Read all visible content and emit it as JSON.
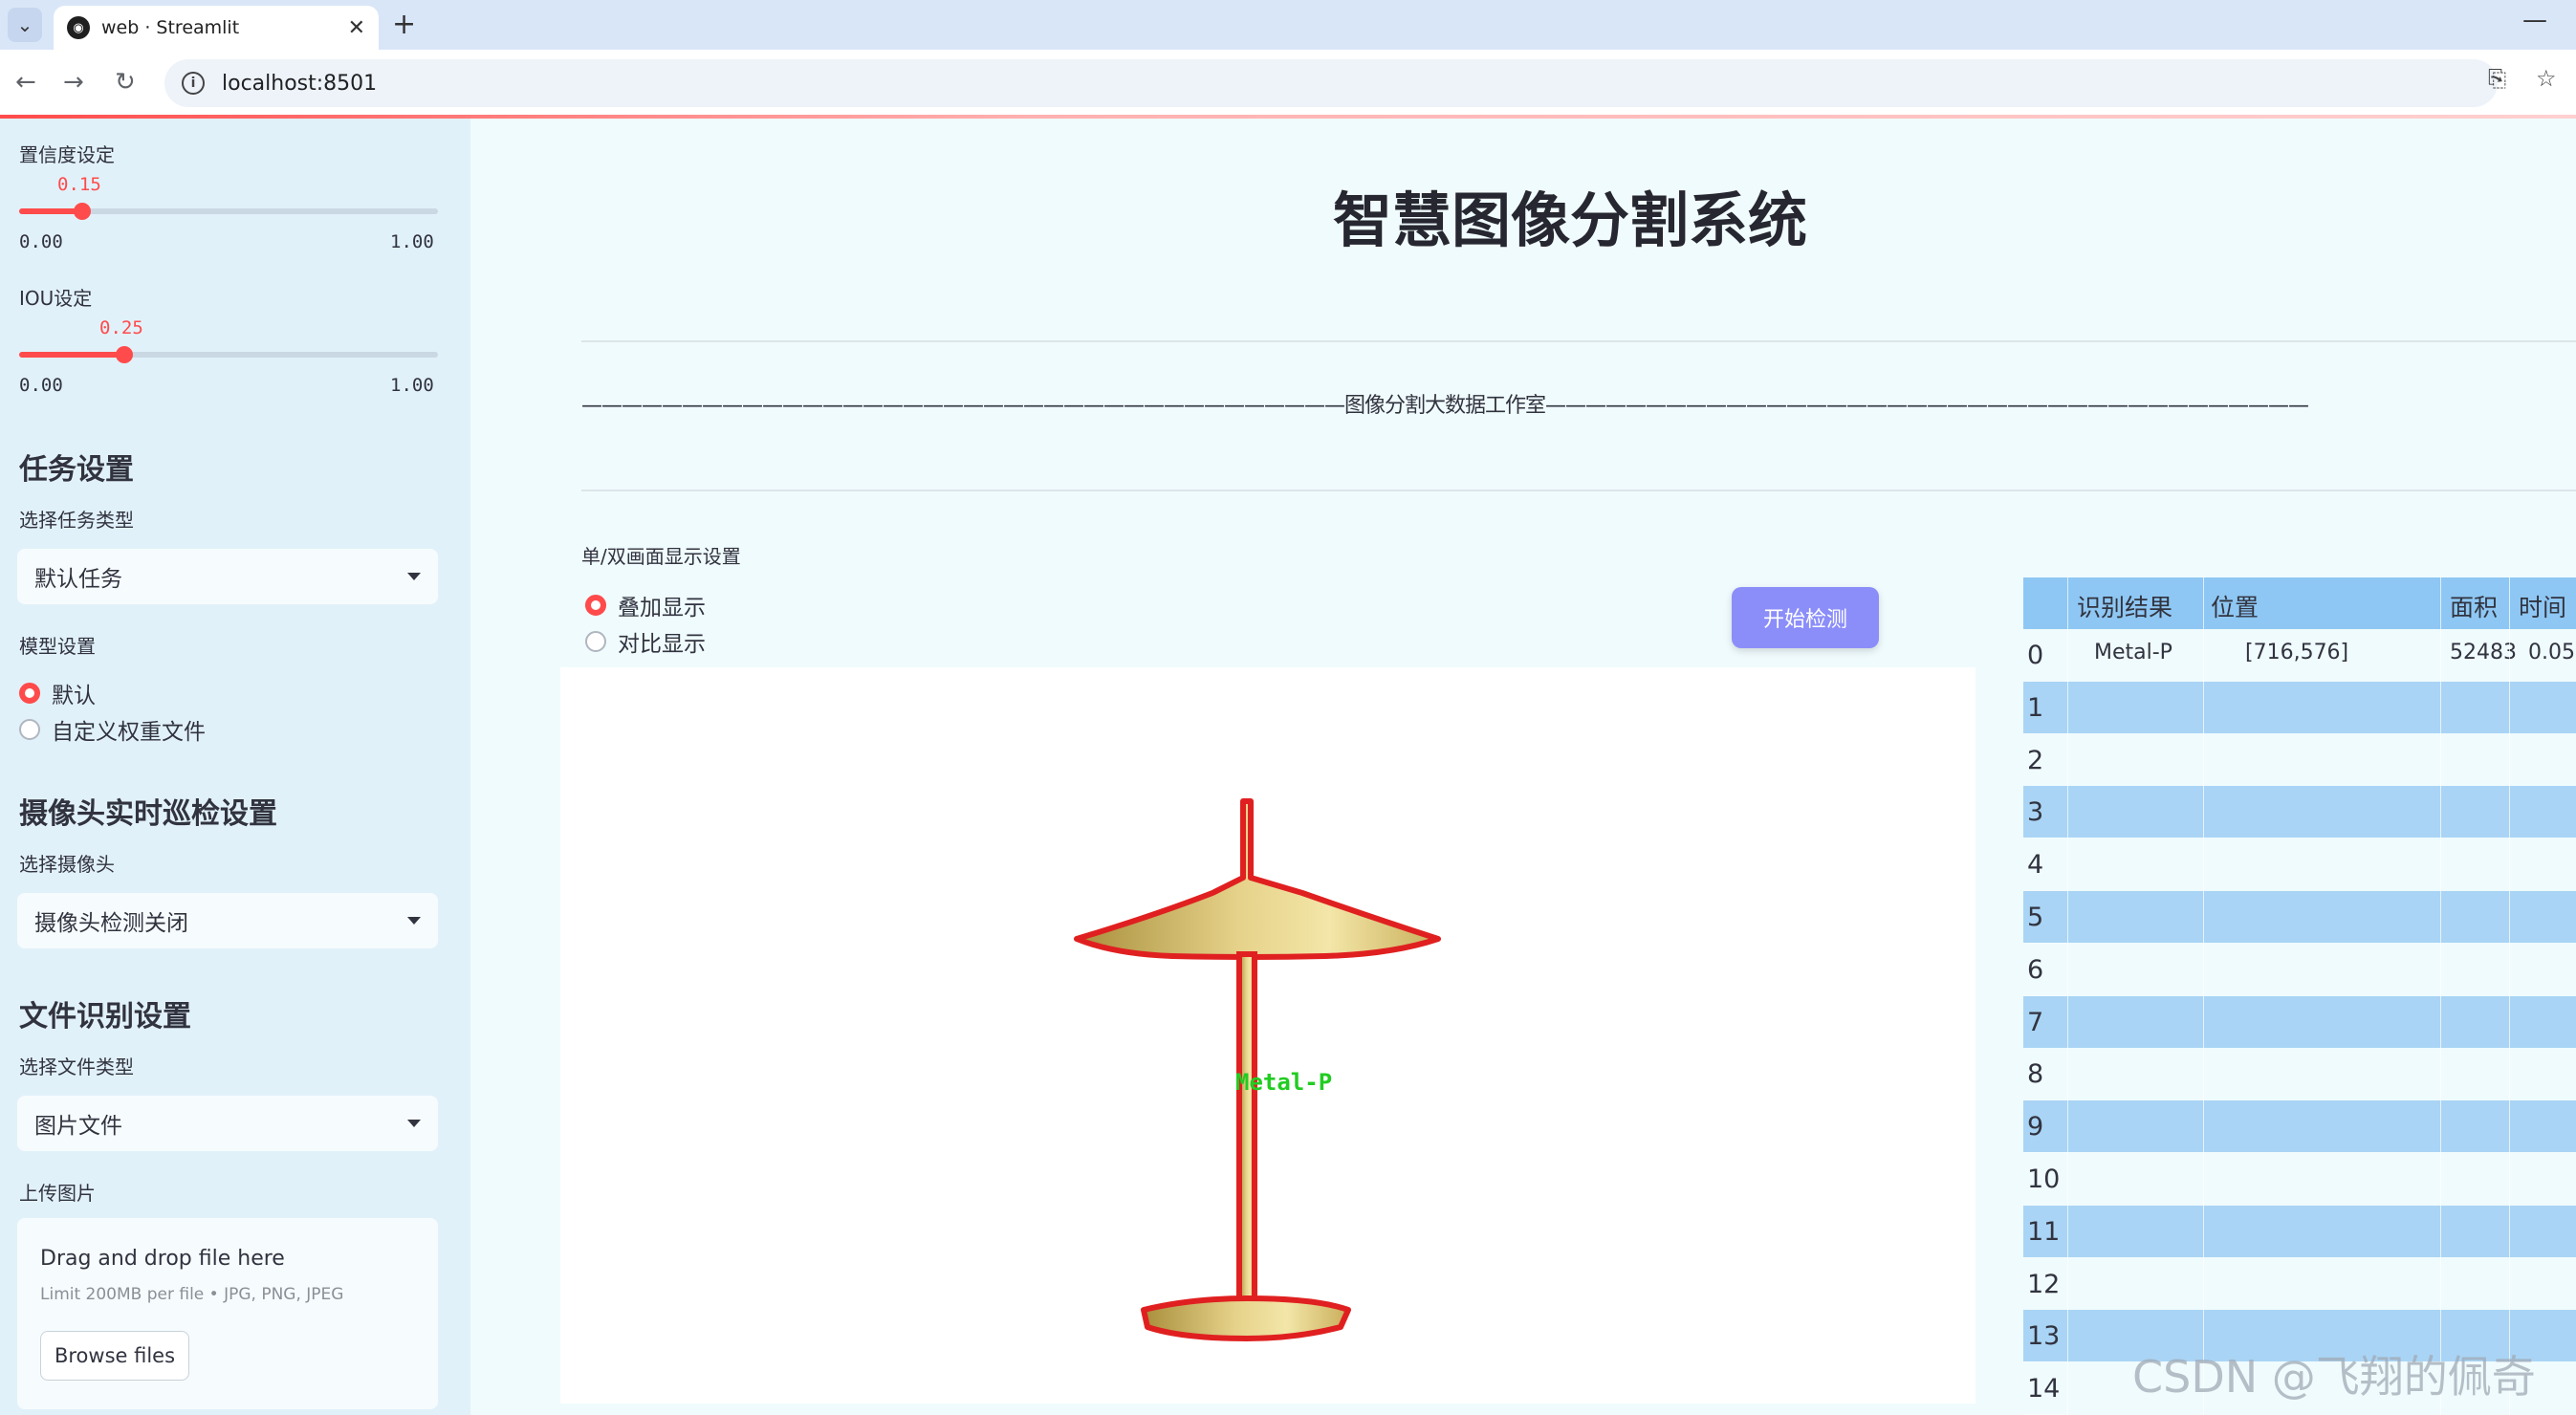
{
  "browser": {
    "tab_title": "web · Streamlit",
    "url": "localhost:8501"
  },
  "sidebar": {
    "confidence": {
      "label": "置信度设定",
      "value": "0.15",
      "value_fraction": 0.15,
      "min": "0.00",
      "max": "1.00"
    },
    "iou": {
      "label": "IOU设定",
      "value": "0.25",
      "value_fraction": 0.25,
      "min": "0.00",
      "max": "1.00"
    },
    "task_section": {
      "title": "任务设置",
      "label": "选择任务类型",
      "selected": "默认任务"
    },
    "model_section": {
      "label": "模型设置",
      "options": [
        "默认",
        "自定义权重文件"
      ],
      "selected_index": 0
    },
    "camera_section": {
      "title": "摄像头实时巡检设置",
      "label": "选择摄像头",
      "selected": "摄像头检测关闭"
    },
    "file_section": {
      "title": "文件识别设置",
      "label": "选择文件类型",
      "selected": "图片文件"
    },
    "upload": {
      "label": "上传图片",
      "drag_text": "Drag and drop file here",
      "limit_text": "Limit 200MB per file • JPG, PNG, JPEG",
      "browse_label": "Browse files"
    }
  },
  "main": {
    "title": "智慧图像分割系统",
    "banner": "——————————————————————————————————————图像分割大数据工作室——————————————————————————————————————",
    "display_label": "单/双画面显示设置",
    "display_options": [
      "叠加显示",
      "对比显示"
    ],
    "display_selected_index": 0,
    "detect_button": "开始检测",
    "detection_label": "Metal-P"
  },
  "table": {
    "headers": [
      "识别结果",
      "位置",
      "面积",
      "时间"
    ],
    "rows": [
      {
        "index": "0",
        "result": "Metal-P",
        "position": "[716,576]",
        "area": "52483",
        "time": "0.05"
      },
      {
        "index": "1"
      },
      {
        "index": "2"
      },
      {
        "index": "3"
      },
      {
        "index": "4"
      },
      {
        "index": "5"
      },
      {
        "index": "6"
      },
      {
        "index": "7"
      },
      {
        "index": "8"
      },
      {
        "index": "9"
      },
      {
        "index": "10"
      },
      {
        "index": "11"
      },
      {
        "index": "12"
      },
      {
        "index": "13"
      },
      {
        "index": "14"
      }
    ]
  },
  "watermark": "CSDN @飞翔的佩奇",
  "colors": {
    "accent": "#ff4b4b",
    "button": "#8b8ef9",
    "table_header": "#8ec7f3",
    "mask_outline": "#e02020",
    "label_green": "#22cc22"
  }
}
